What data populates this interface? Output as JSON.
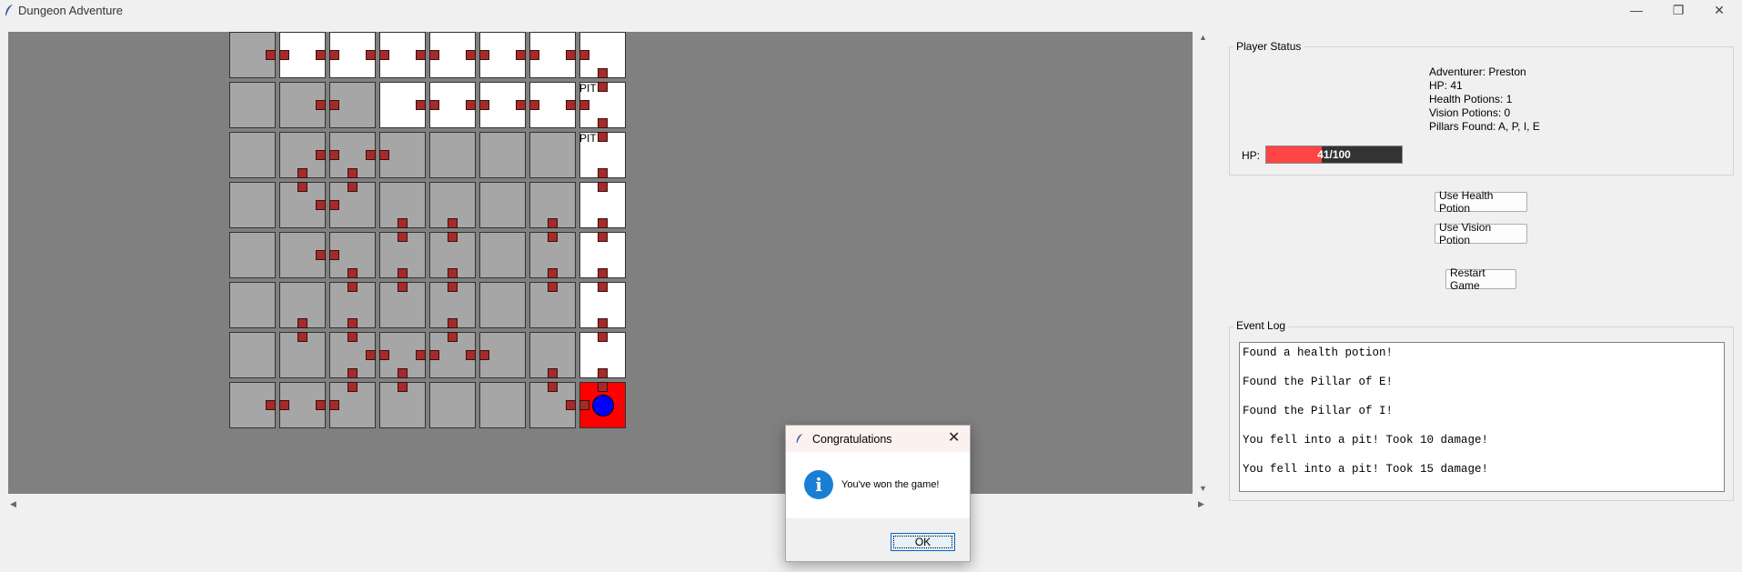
{
  "window": {
    "title": "Dungeon Adventure",
    "icon": "feather-icon"
  },
  "board": {
    "rows": 8,
    "cols": 8,
    "background": "#808080",
    "cells": [
      [
        "grey",
        "white",
        "white",
        "white",
        "white",
        "white",
        "white",
        "white"
      ],
      [
        "grey",
        "grey",
        "grey",
        "white",
        "white",
        "white",
        "white",
        "white"
      ],
      [
        "grey",
        "grey",
        "grey",
        "grey",
        "grey",
        "grey",
        "grey",
        "white"
      ],
      [
        "grey",
        "grey",
        "grey",
        "grey",
        "grey",
        "grey",
        "grey",
        "white"
      ],
      [
        "grey",
        "grey",
        "grey",
        "grey",
        "grey",
        "grey",
        "grey",
        "white"
      ],
      [
        "grey",
        "grey",
        "grey",
        "grey",
        "grey",
        "grey",
        "grey",
        "white"
      ],
      [
        "grey",
        "grey",
        "grey",
        "grey",
        "grey",
        "grey",
        "grey",
        "white"
      ],
      [
        "grey",
        "grey",
        "grey",
        "grey",
        "grey",
        "grey",
        "grey",
        "red"
      ]
    ],
    "labels": [
      {
        "row": 1,
        "col": 7,
        "text": "PIT"
      },
      {
        "row": 2,
        "col": 7,
        "text": "PIT"
      }
    ],
    "h_doors": [
      [
        0,
        0
      ],
      [
        0,
        1
      ],
      [
        0,
        2
      ],
      [
        0,
        3
      ],
      [
        0,
        4
      ],
      [
        0,
        5
      ],
      [
        0,
        6
      ],
      [
        1,
        1
      ],
      [
        1,
        3
      ],
      [
        1,
        4
      ],
      [
        1,
        5
      ],
      [
        1,
        6
      ],
      [
        2,
        1
      ],
      [
        2,
        2
      ],
      [
        3,
        1
      ],
      [
        4,
        1
      ],
      [
        6,
        2
      ],
      [
        6,
        3
      ],
      [
        6,
        4
      ],
      [
        7,
        0
      ],
      [
        7,
        1
      ],
      [
        7,
        6
      ]
    ],
    "v_doors": [
      [
        0,
        7
      ],
      [
        1,
        7
      ],
      [
        2,
        1
      ],
      [
        2,
        2
      ],
      [
        2,
        7
      ],
      [
        3,
        3
      ],
      [
        3,
        4
      ],
      [
        3,
        6
      ],
      [
        3,
        7
      ],
      [
        4,
        2
      ],
      [
        4,
        3
      ],
      [
        4,
        4
      ],
      [
        4,
        6
      ],
      [
        4,
        7
      ],
      [
        5,
        1
      ],
      [
        5,
        2
      ],
      [
        5,
        4
      ],
      [
        5,
        7
      ],
      [
        6,
        2
      ],
      [
        6,
        3
      ],
      [
        6,
        6
      ],
      [
        6,
        7
      ]
    ],
    "player": {
      "row": 7,
      "col": 7,
      "color": "#0000ff"
    }
  },
  "status": {
    "group_title": "Player Status",
    "lines": [
      "Adventurer: Preston",
      "HP: 41",
      "Health Potions: 1",
      "Vision Potions: 0",
      "Pillars Found: A, P, I, E"
    ],
    "hp_label": "HP:",
    "hp_bar_text": "41/100",
    "hp_value": 41,
    "hp_max": 100,
    "hp_color": "#ff4444"
  },
  "buttons": {
    "health_potion": "Use Health Potion",
    "vision_potion": "Use Vision Potion",
    "restart": "Restart Game"
  },
  "event_log": {
    "group_title": "Event Log",
    "entries": [
      "Found a health potion!",
      "Found the Pillar of E!",
      "Found the Pillar of I!",
      "You fell into a pit! Took 10 damage!",
      "You fell into a pit! Took 15 damage!"
    ]
  },
  "dialog": {
    "title": "Congratulations",
    "message": "You've won the game!",
    "ok_label": "OK",
    "icon": "info-icon"
  }
}
